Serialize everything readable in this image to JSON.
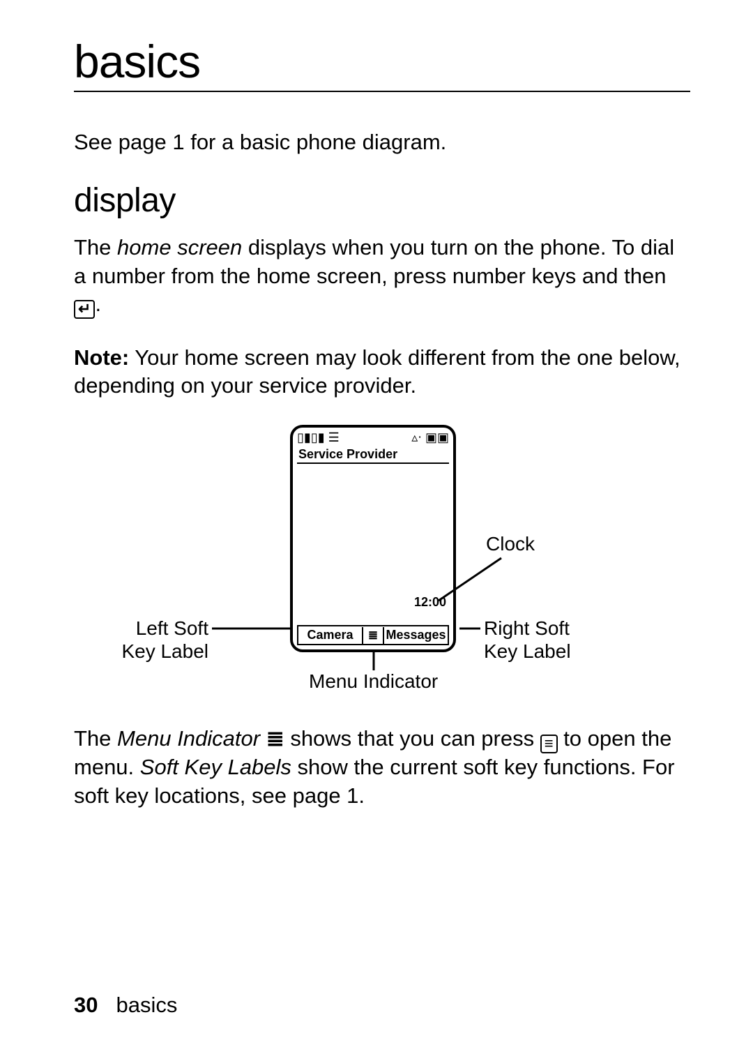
{
  "heading": "basics",
  "intro": "See page 1 for a basic phone diagram.",
  "section_heading": "display",
  "p1_a": "The ",
  "p1_i": "home screen",
  "p1_b": " displays when you turn on the phone. To dial a number from the home screen, press number keys and then ",
  "note_label": "Note:",
  "note_body": " Your home screen may look different from the one below, depending on your service provider.",
  "diagram": {
    "service_provider": "Service Provider",
    "clock_value": "12:00",
    "left_soft": "Camera",
    "right_soft": "Messages",
    "menu_glyph": "≣",
    "callout_clock": "Clock",
    "callout_left1": "Left Soft",
    "callout_left2": "Key Label",
    "callout_right1": "Right Soft",
    "callout_right2": "Key Label",
    "callout_menu": "Menu Indicator"
  },
  "p2_a": "The ",
  "p2_i1": "Menu Indicator",
  "p2_b": " ",
  "p2_c": " shows that you can press ",
  "p2_d": " to open the menu. ",
  "p2_i2": "Soft Key Labels",
  "p2_e": " show the current soft key functions. For soft key locations, see page 1.",
  "footer_page": "30",
  "footer_section": "basics"
}
